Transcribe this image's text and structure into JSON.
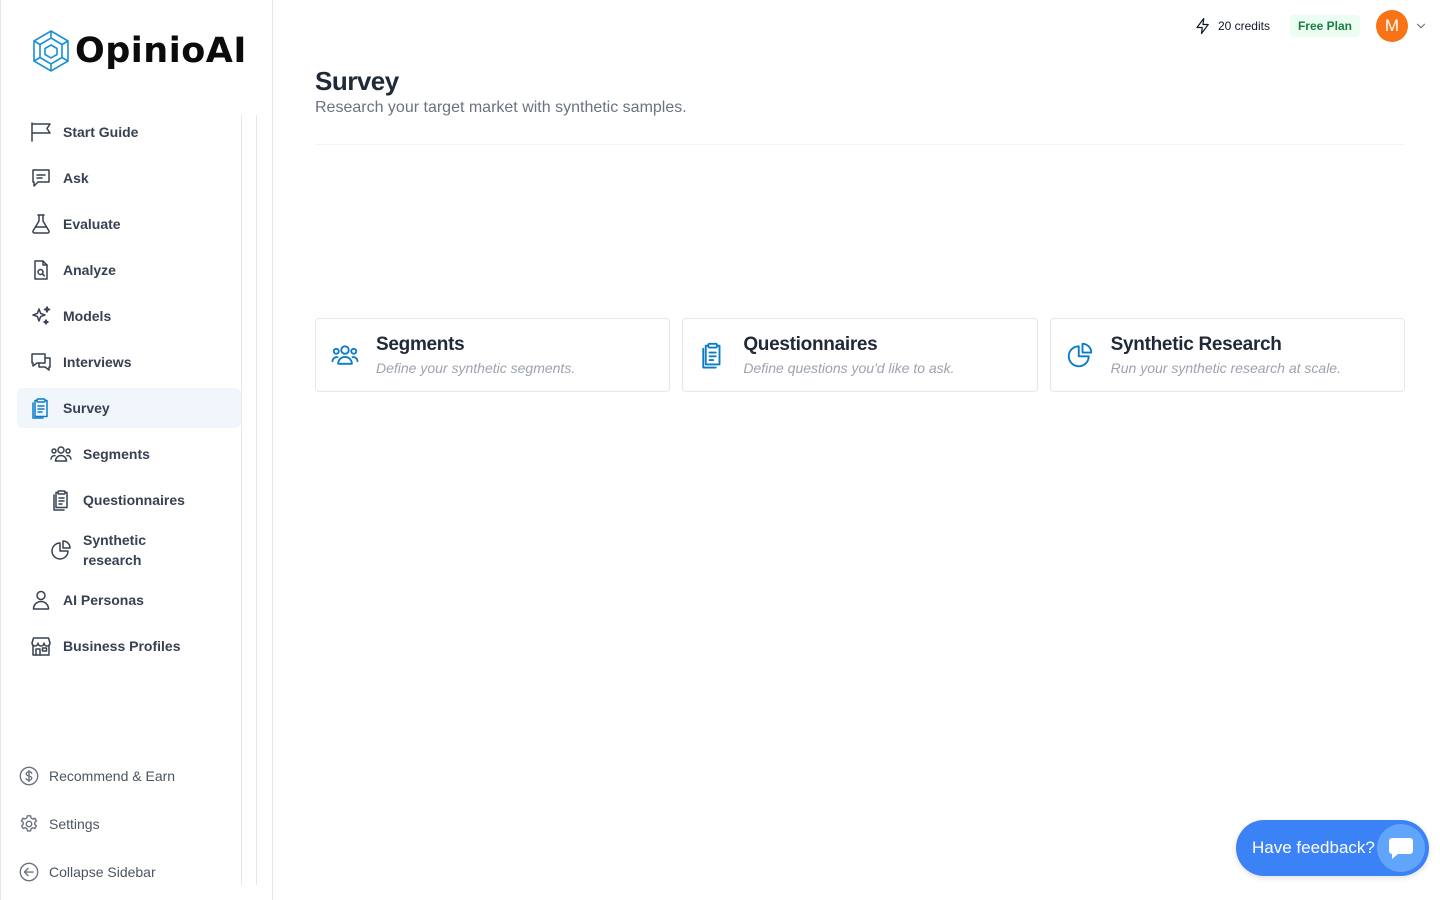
{
  "app": {
    "name": "OpinioAI"
  },
  "sidebar": {
    "items": [
      {
        "label": "Start Guide",
        "icon": "flag-icon"
      },
      {
        "label": "Ask",
        "icon": "chat-icon"
      },
      {
        "label": "Evaluate",
        "icon": "flask-icon"
      },
      {
        "label": "Analyze",
        "icon": "document-search-icon"
      },
      {
        "label": "Models",
        "icon": "sparkles-icon"
      },
      {
        "label": "Interviews",
        "icon": "chat-bubbles-icon"
      },
      {
        "label": "Survey",
        "icon": "clipboard-icon",
        "active": true
      },
      {
        "label": "Segments",
        "icon": "users-icon",
        "sub": true
      },
      {
        "label": "Questionnaires",
        "icon": "clipboard-list-icon",
        "sub": true
      },
      {
        "label": "Synthetic research",
        "icon": "pie-chart-icon",
        "sub": true
      },
      {
        "label": "AI Personas",
        "icon": "user-icon"
      },
      {
        "label": "Business Profiles",
        "icon": "storefront-icon"
      }
    ],
    "bottom": [
      {
        "label": "Recommend & Earn",
        "icon": "dollar-circle-icon"
      },
      {
        "label": "Settings",
        "icon": "gear-icon"
      },
      {
        "label": "Collapse Sidebar",
        "icon": "arrow-left-circle-icon"
      }
    ]
  },
  "header": {
    "credits": "20 credits",
    "plan": "Free Plan",
    "avatar_initial": "M"
  },
  "main": {
    "title": "Survey",
    "subtitle": "Research your target market with synthetic samples.",
    "cards": [
      {
        "title": "Segments",
        "description": "Define your synthetic segments.",
        "icon": "users-icon"
      },
      {
        "title": "Questionnaires",
        "description": "Define questions you'd like to ask.",
        "icon": "clipboard-list-icon"
      },
      {
        "title": "Synthetic Research",
        "description": "Run your synthetic research at scale.",
        "icon": "pie-chart-icon"
      }
    ]
  },
  "feedback": {
    "label": "Have feedback?"
  },
  "colors": {
    "accent": "#0a7cc9",
    "active_bg": "#f0f6fc",
    "avatar": "#f97316",
    "feedback": "#3b82f6",
    "plan_bg": "#ecfdf3",
    "plan_text": "#15803d"
  }
}
